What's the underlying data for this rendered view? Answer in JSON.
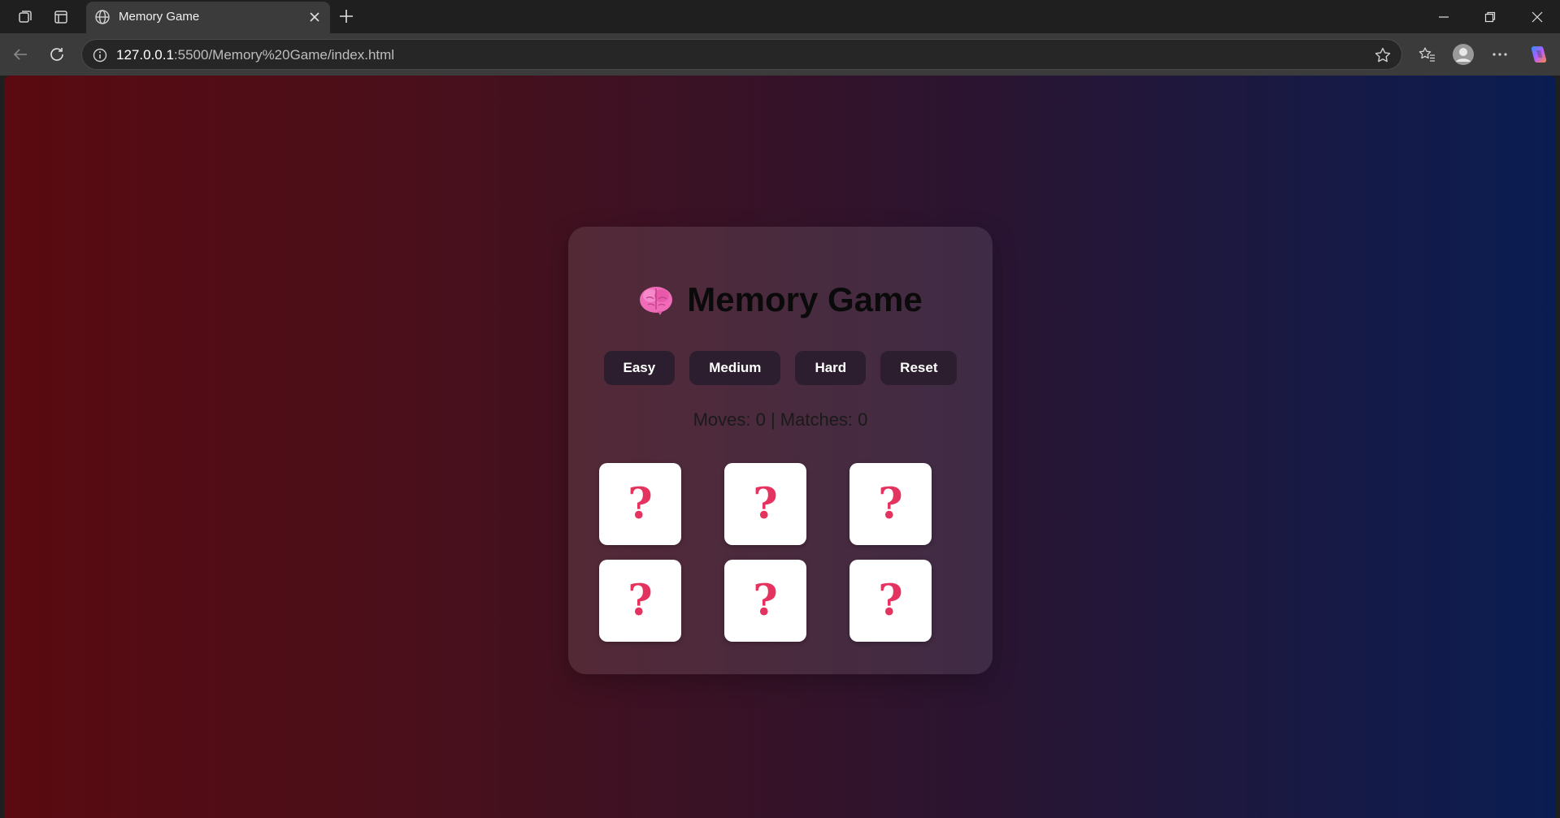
{
  "browser": {
    "tab_title": "Memory Game",
    "url_host": "127.0.0.1",
    "url_path": ":5500/Memory%20Game/index.html"
  },
  "game": {
    "title": "Memory Game",
    "title_icon": "brain-emoji",
    "buttons": {
      "easy": "Easy",
      "medium": "Medium",
      "hard": "Hard",
      "reset": "Reset"
    },
    "stats_text": "Moves: 0 | Matches: 0",
    "cards": [
      {
        "face": "?"
      },
      {
        "face": "?"
      },
      {
        "face": "?"
      },
      {
        "face": "?"
      },
      {
        "face": "?"
      },
      {
        "face": "?"
      }
    ]
  },
  "colors": {
    "gradient_left": "#5a0a10",
    "gradient_right": "#0a1d52",
    "card_question": "#e5335f",
    "button_bg": "#2c1e2e"
  }
}
